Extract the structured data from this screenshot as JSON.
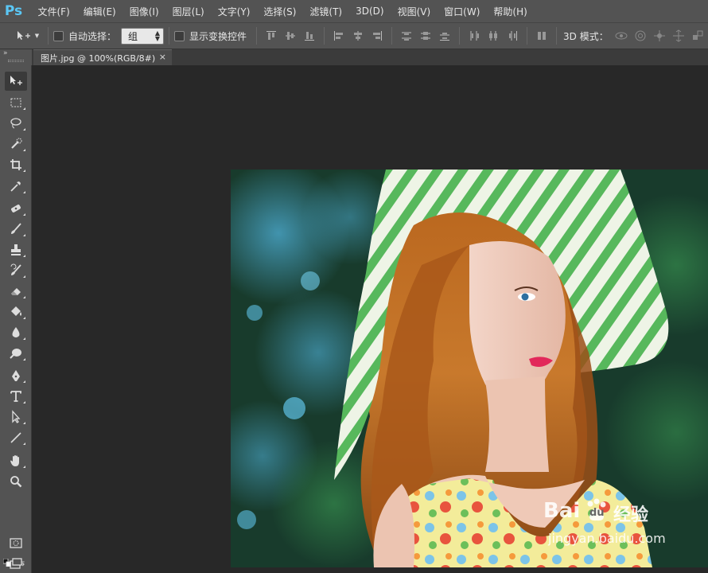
{
  "app": {
    "logo": "Ps"
  },
  "menu": [
    "文件(F)",
    "编辑(E)",
    "图像(I)",
    "图层(L)",
    "文字(Y)",
    "选择(S)",
    "滤镜(T)",
    "3D(D)",
    "视图(V)",
    "窗口(W)",
    "帮助(H)"
  ],
  "options": {
    "auto_select_label": "自动选择：",
    "auto_select_value": "组",
    "show_transform_label": "显示变换控件",
    "mode_3d_label": "3D 模式："
  },
  "document": {
    "tab_title": "图片.jpg @ 100%(RGB/8#)",
    "close_glyph": "×"
  },
  "colors": {
    "foreground": "#7fe49c",
    "background": "#f6d4d4",
    "ps_blue": "#5bc7f5"
  },
  "tools": [
    "move-tool-icon",
    "marquee-tool-icon",
    "lasso-tool-icon",
    "quick-selection-tool-icon",
    "crop-tool-icon",
    "eyedropper-tool-icon",
    "healing-brush-tool-icon",
    "brush-tool-icon",
    "clone-stamp-tool-icon",
    "history-brush-tool-icon",
    "eraser-tool-icon",
    "paint-bucket-tool-icon",
    "blur-tool-icon",
    "dodge-tool-icon",
    "pen-tool-icon",
    "type-tool-icon",
    "path-selection-tool-icon",
    "line-tool-icon",
    "hand-tool-icon",
    "zoom-tool-icon"
  ],
  "watermark": {
    "brand": "Bai",
    "brand_suffix": "du",
    "product": "经验",
    "url": "jingyan.baidu.com"
  }
}
